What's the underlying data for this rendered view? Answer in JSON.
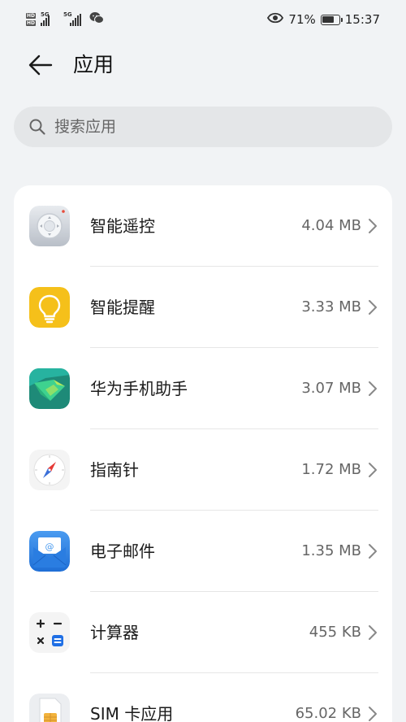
{
  "status_bar": {
    "hd1": "HD",
    "hd2": "HD",
    "net1": "5G",
    "net2": "5G",
    "battery_percent": "71%",
    "battery_level": 0.71,
    "time": "15:37"
  },
  "header": {
    "title": "应用"
  },
  "search": {
    "placeholder": "搜索应用"
  },
  "apps": [
    {
      "name": "智能遥控",
      "size": "4.04 MB",
      "icon": "remote-control-icon"
    },
    {
      "name": "智能提醒",
      "size": "3.33 MB",
      "icon": "lightbulb-icon"
    },
    {
      "name": "华为手机助手",
      "size": "3.07 MB",
      "icon": "phone-assistant-icon"
    },
    {
      "name": "指南针",
      "size": "1.72 MB",
      "icon": "compass-icon"
    },
    {
      "name": "电子邮件",
      "size": "1.35 MB",
      "icon": "email-icon"
    },
    {
      "name": "计算器",
      "size": "455 KB",
      "icon": "calculator-icon"
    },
    {
      "name": "SIM 卡应用",
      "size": "65.02 KB",
      "icon": "sim-card-icon"
    }
  ],
  "colors": {
    "background": "#f1f3f5",
    "card": "#ffffff",
    "search_bg": "#e4e6e8",
    "remote_icon": "#c9ced6",
    "reminder_icon": "#f5c01a",
    "assistant_icon": "#1e8a78",
    "email_icon": "#2a7de1",
    "calculator_accent": "#1f6fe5"
  }
}
